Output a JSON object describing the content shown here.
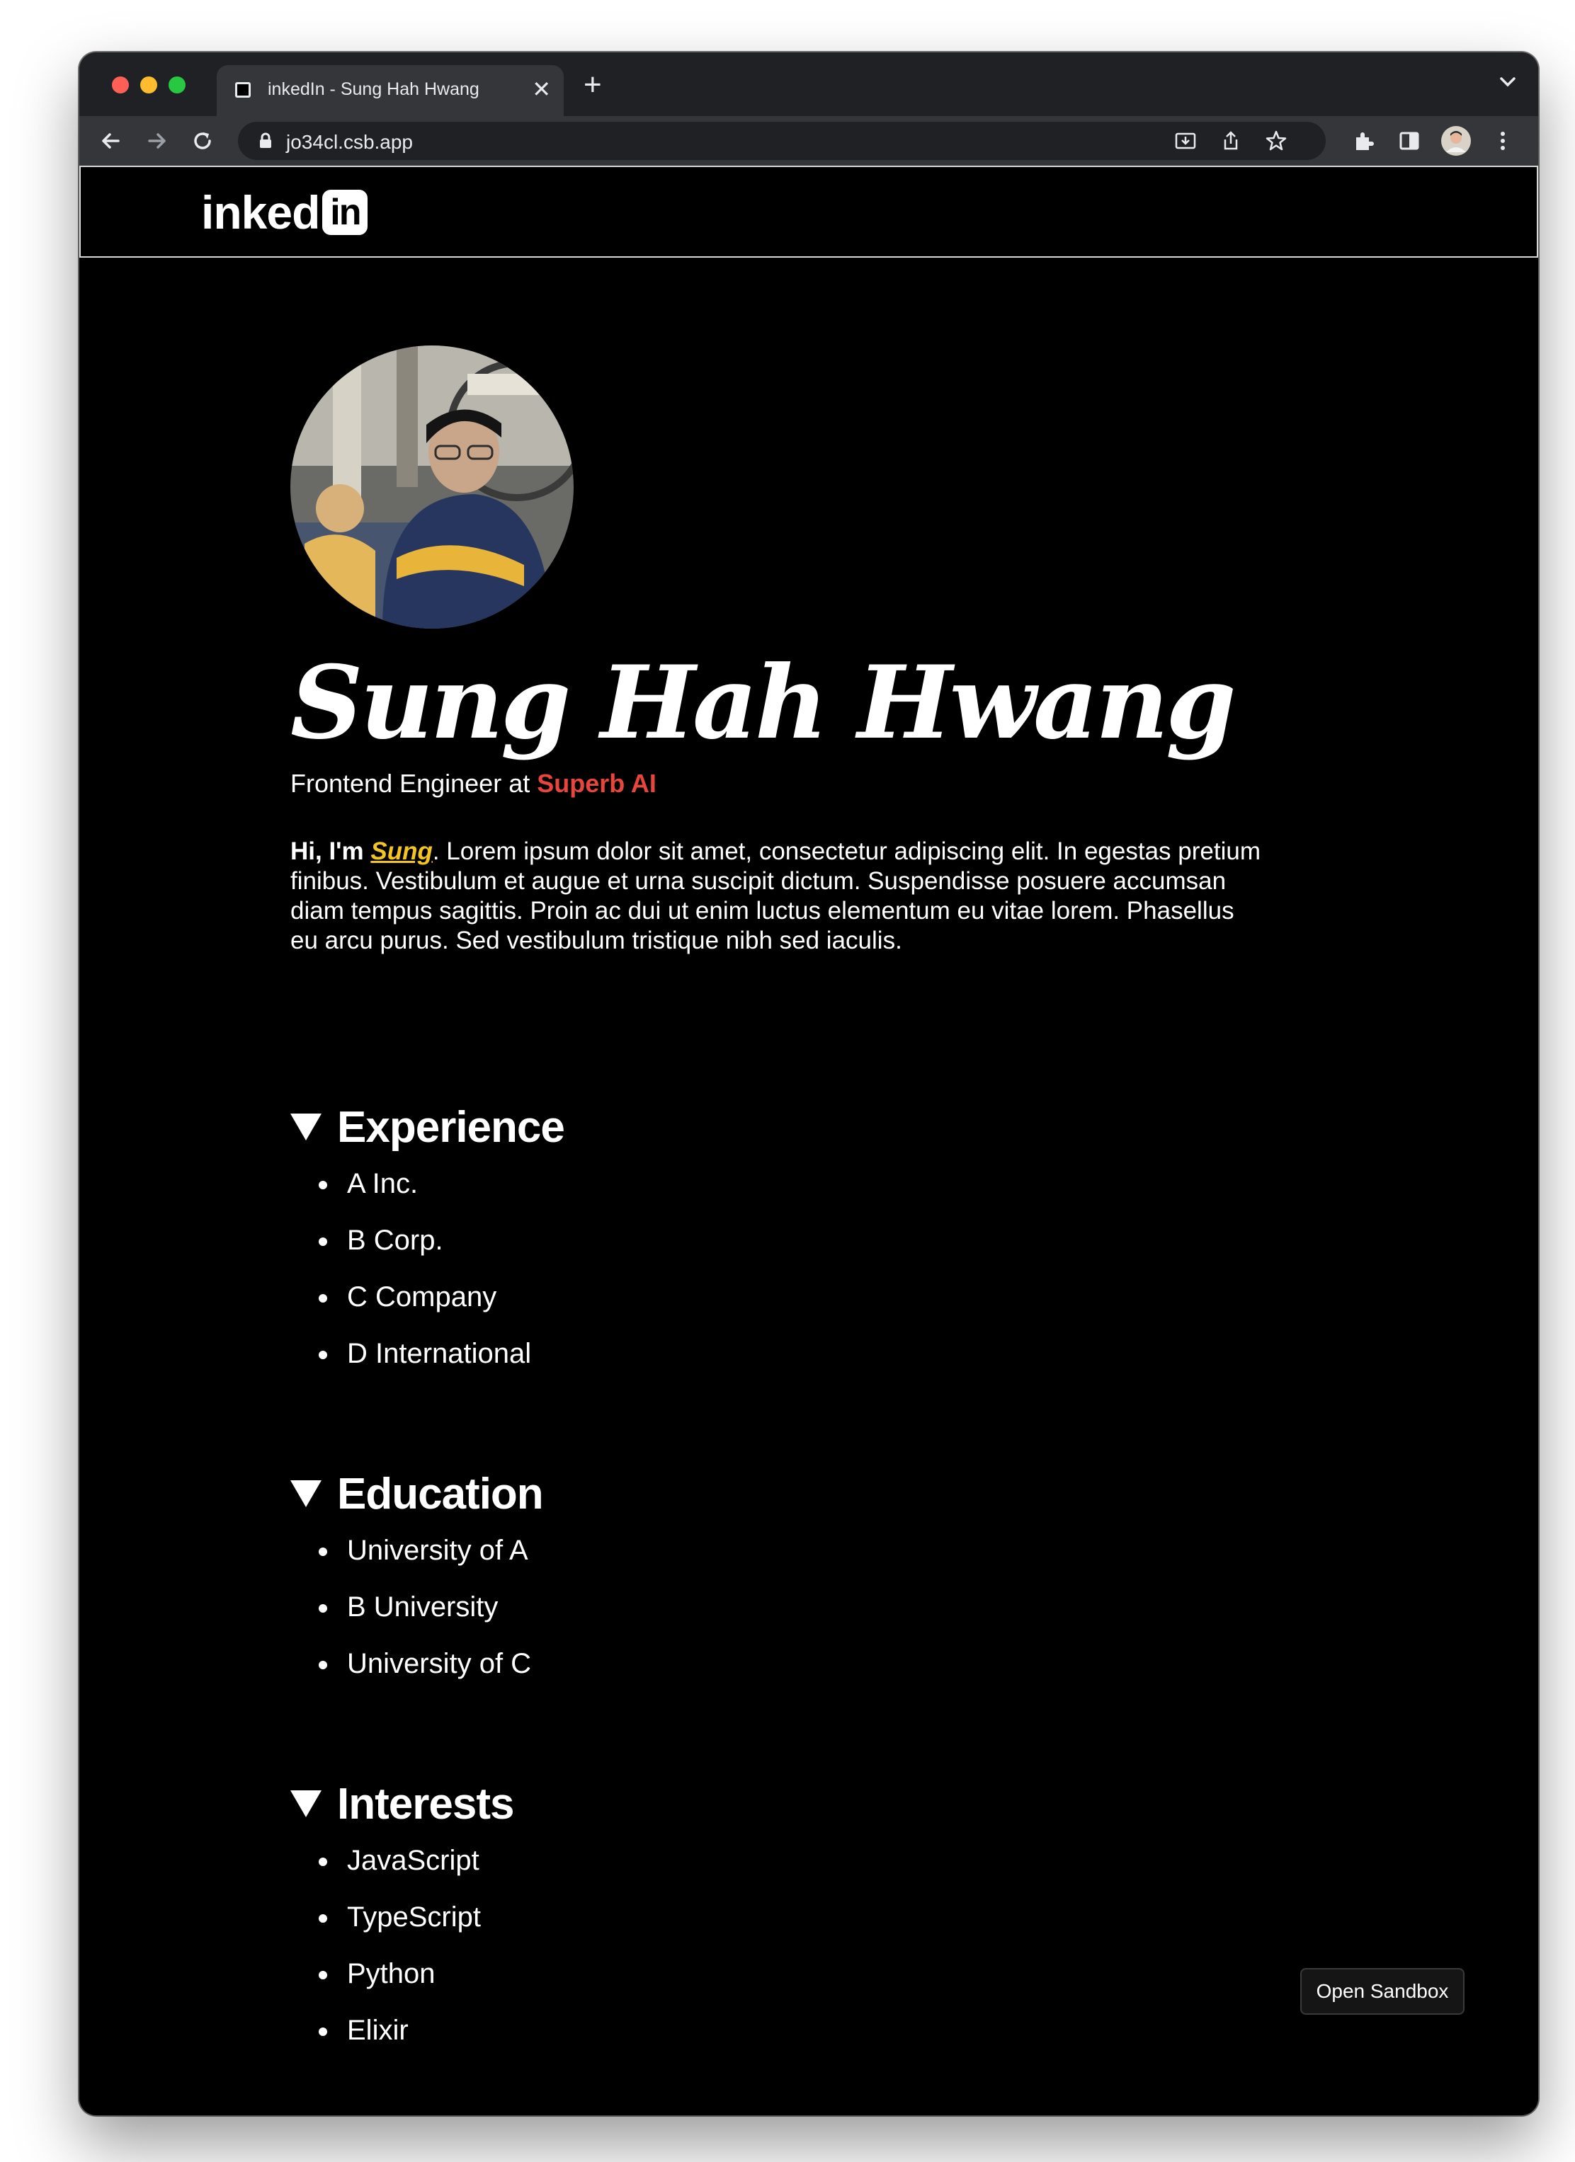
{
  "browser": {
    "tab_title": "inkedIn - Sung Hah Hwang",
    "url": "jo34cl.csb.app"
  },
  "site": {
    "logo_text": "inked",
    "logo_box": "in"
  },
  "profile": {
    "name": "Sung Hah Hwang",
    "role_prefix": "Frontend Engineer at ",
    "company": "Superb AI",
    "bio_greeting": "Hi, I'm ",
    "bio_nickname": "Sung",
    "bio_text": ". Lorem ipsum dolor sit amet, consectetur adipiscing elit. In egestas pretium finibus. Vestibulum et augue et urna suscipit dictum. Suspendisse posuere accumsan diam tempus sagittis. Proin ac dui ut enim luctus elementum eu vitae lorem. Phasellus eu arcu purus. Sed vestibulum tristique nibh sed iaculis."
  },
  "sections": [
    {
      "title": "Experience",
      "items": [
        "A Inc.",
        "B Corp.",
        "C Company",
        "D International"
      ]
    },
    {
      "title": "Education",
      "items": [
        "University of A",
        "B University",
        "University of C"
      ]
    },
    {
      "title": "Interests",
      "items": [
        "JavaScript",
        "TypeScript",
        "Python",
        "Elixir"
      ]
    }
  ],
  "sandbox_button": "Open Sandbox"
}
